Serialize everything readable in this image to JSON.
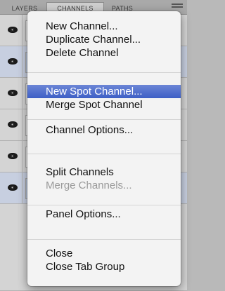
{
  "panel": {
    "tabs": [
      {
        "label": "LAYERS"
      },
      {
        "label": "CHANNELS"
      },
      {
        "label": "PATHS"
      }
    ]
  },
  "menu": {
    "items": [
      {
        "label": "New Channel...",
        "enabled": true
      },
      {
        "label": "Duplicate Channel...",
        "enabled": true
      },
      {
        "label": "Delete Channel",
        "enabled": true
      },
      {
        "label": "New Spot Channel...",
        "enabled": true,
        "highlighted": true
      },
      {
        "label": "Merge Spot Channel",
        "enabled": true
      },
      {
        "label": "Channel Options...",
        "enabled": true
      },
      {
        "label": "Split Channels",
        "enabled": true
      },
      {
        "label": "Merge Channels...",
        "enabled": false
      },
      {
        "label": "Panel Options...",
        "enabled": true
      },
      {
        "label": "Close",
        "enabled": true
      },
      {
        "label": "Close Tab Group",
        "enabled": true
      }
    ]
  },
  "colors": {
    "highlight": "#4a6bcc",
    "menu_background": "#f3f3f3",
    "disabled_text": "#9a9a9a"
  }
}
